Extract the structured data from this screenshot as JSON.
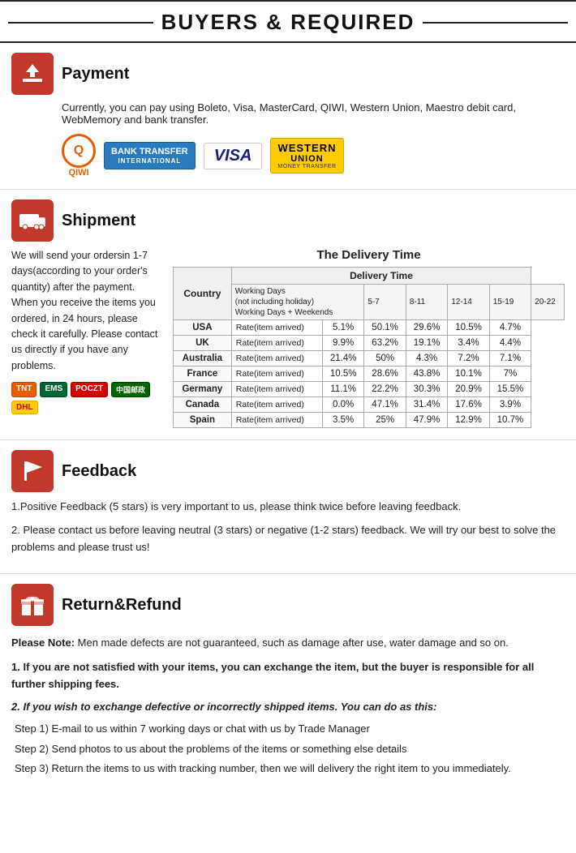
{
  "header": {
    "title": "BUYERS & REQUIRED"
  },
  "payment": {
    "section_title": "Payment",
    "description": "Currently, you can pay using Boleto, Visa, MasterCard, QIWI, Western Union, Maestro  debit card, WebMemory and bank transfer.",
    "logos": {
      "qiwi": "QIWI",
      "bank": "BANK TRANSFER",
      "bank_sub": "INTERNATIONAL",
      "visa": "VISA",
      "wu_top": "WESTERN",
      "wu_name": "UNION",
      "wu_sub": "MONEY TRANSFER"
    }
  },
  "shipment": {
    "section_title": "Shipment",
    "body_text": "We will send your ordersin 1-7 days(according to your order's quantity) after the payment. When you receive the items you ordered, in 24  hours, please check it carefully. Please  contact us directly if you have any problems.",
    "carriers": [
      "TNT",
      "EMS",
      "POCZT",
      "CHINAPOST",
      "DHL"
    ],
    "delivery_title": "The Delivery Time",
    "table": {
      "col_headers": [
        "Country",
        "Delivery Time"
      ],
      "sub_headers": [
        "Working Days\n(not including holiday)",
        "Working Days + Weekends"
      ],
      "day_ranges": [
        "5-7",
        "8-11",
        "12-14",
        "15-19",
        "20-22"
      ],
      "rows": [
        {
          "country": "USA",
          "type": "Rate(item arrived)",
          "values": [
            "5.1%",
            "50.1%",
            "29.6%",
            "10.5%",
            "4.7%"
          ]
        },
        {
          "country": "UK",
          "type": "Rate(item arrived)",
          "values": [
            "9.9%",
            "63.2%",
            "19.1%",
            "3.4%",
            "4.4%"
          ]
        },
        {
          "country": "Australia",
          "type": "Rate(item arrived)",
          "values": [
            "21.4%",
            "50%",
            "4.3%",
            "7.2%",
            "7.1%"
          ]
        },
        {
          "country": "France",
          "type": "Rate(item arrived)",
          "values": [
            "10.5%",
            "28.6%",
            "43.8%",
            "10.1%",
            "7%"
          ]
        },
        {
          "country": "Germany",
          "type": "Rate(item arrived)",
          "values": [
            "11.1%",
            "22.2%",
            "30.3%",
            "20.9%",
            "15.5%"
          ]
        },
        {
          "country": "Canada",
          "type": "Rate(item arrived)",
          "values": [
            "0.0%",
            "47.1%",
            "31.4%",
            "17.6%",
            "3.9%"
          ]
        },
        {
          "country": "Spain",
          "type": "Rate(item arrived)",
          "values": [
            "3.5%",
            "25%",
            "47.9%",
            "12.9%",
            "10.7%"
          ]
        }
      ]
    }
  },
  "feedback": {
    "section_title": "Feedback",
    "point1": "1.Positive Feedback (5 stars) is very important to us, please think twice before leaving feedback.",
    "point2": "2. Please contact us before leaving neutral (3 stars) or negative  (1-2 stars) feedback. We will try our best to solve the problems and please trust us!"
  },
  "return_refund": {
    "section_title": "Return&Refund",
    "note_label": "Please Note:",
    "note_text": " Men made defects are not guaranteed, such as damage after use, water damage and so on.",
    "point1": "1. If you are not satisfied with your items, you can exchange the item, but the buyer is responsible for all further shipping fees.",
    "point2_label": "2. If you wish to exchange defective or incorrectly shipped items. You can do as this:",
    "step1": "Step 1) E-mail to us within 7 working days or chat with us by Trade Manager",
    "step2": "Step 2) Send photos to us about the problems of the items or something else details",
    "step3": "Step 3) Return the items to us with tracking number, then we will delivery the right item to you immediately."
  }
}
